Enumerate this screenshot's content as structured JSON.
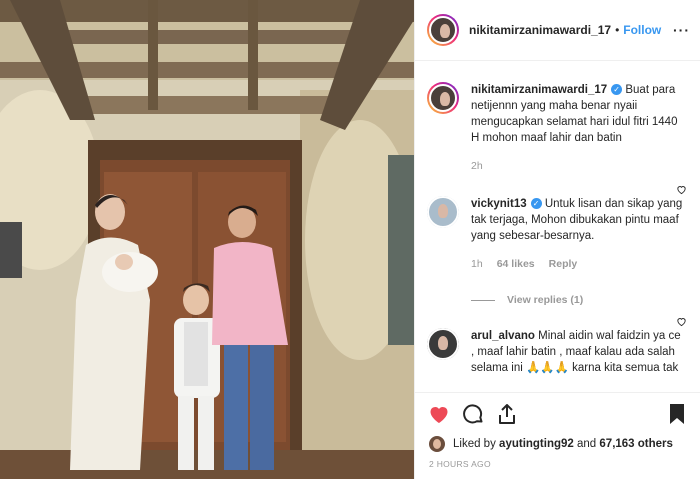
{
  "post": {
    "username": "nikitamirzanimawardi_17",
    "dot": "•",
    "follow_label": "Follow",
    "more_label": "···",
    "caption": "Buat para netijennn yang maha benar nyaii mengucapkan selamat hari idul fitri 1440 H mohon maaf lahir dan batin",
    "caption_time": "2h"
  },
  "comments": [
    {
      "username": "vickynit13",
      "text": "Untuk lisan dan sikap yang tak terjaga, Mohon dibukakan pintu maaf yang sebesar-besarnya.",
      "time": "1h",
      "likes": "64 likes",
      "reply_label": "Reply",
      "view_replies": "View replies (1)"
    },
    {
      "username": "arul_alvano",
      "text": "Minal aidin wal faidzin ya ce , maaf lahir batin , maaf kalau ada salah selama ini 🙏🙏🙏 karna kita semua tak"
    }
  ],
  "footer": {
    "liked_prefix": "Liked by",
    "liked_user": "ayutingting92",
    "liked_and": "and",
    "liked_others": "67,163 others",
    "posted_ago": "2 HOURS AGO"
  },
  "icons": {
    "heart": "heart-icon",
    "comment": "comment-icon",
    "share": "share-icon",
    "save": "bookmark-icon",
    "verified": "verified-badge-icon"
  },
  "colors": {
    "accent": "#3897f0",
    "like_red": "#ed4956",
    "muted": "#999999"
  }
}
